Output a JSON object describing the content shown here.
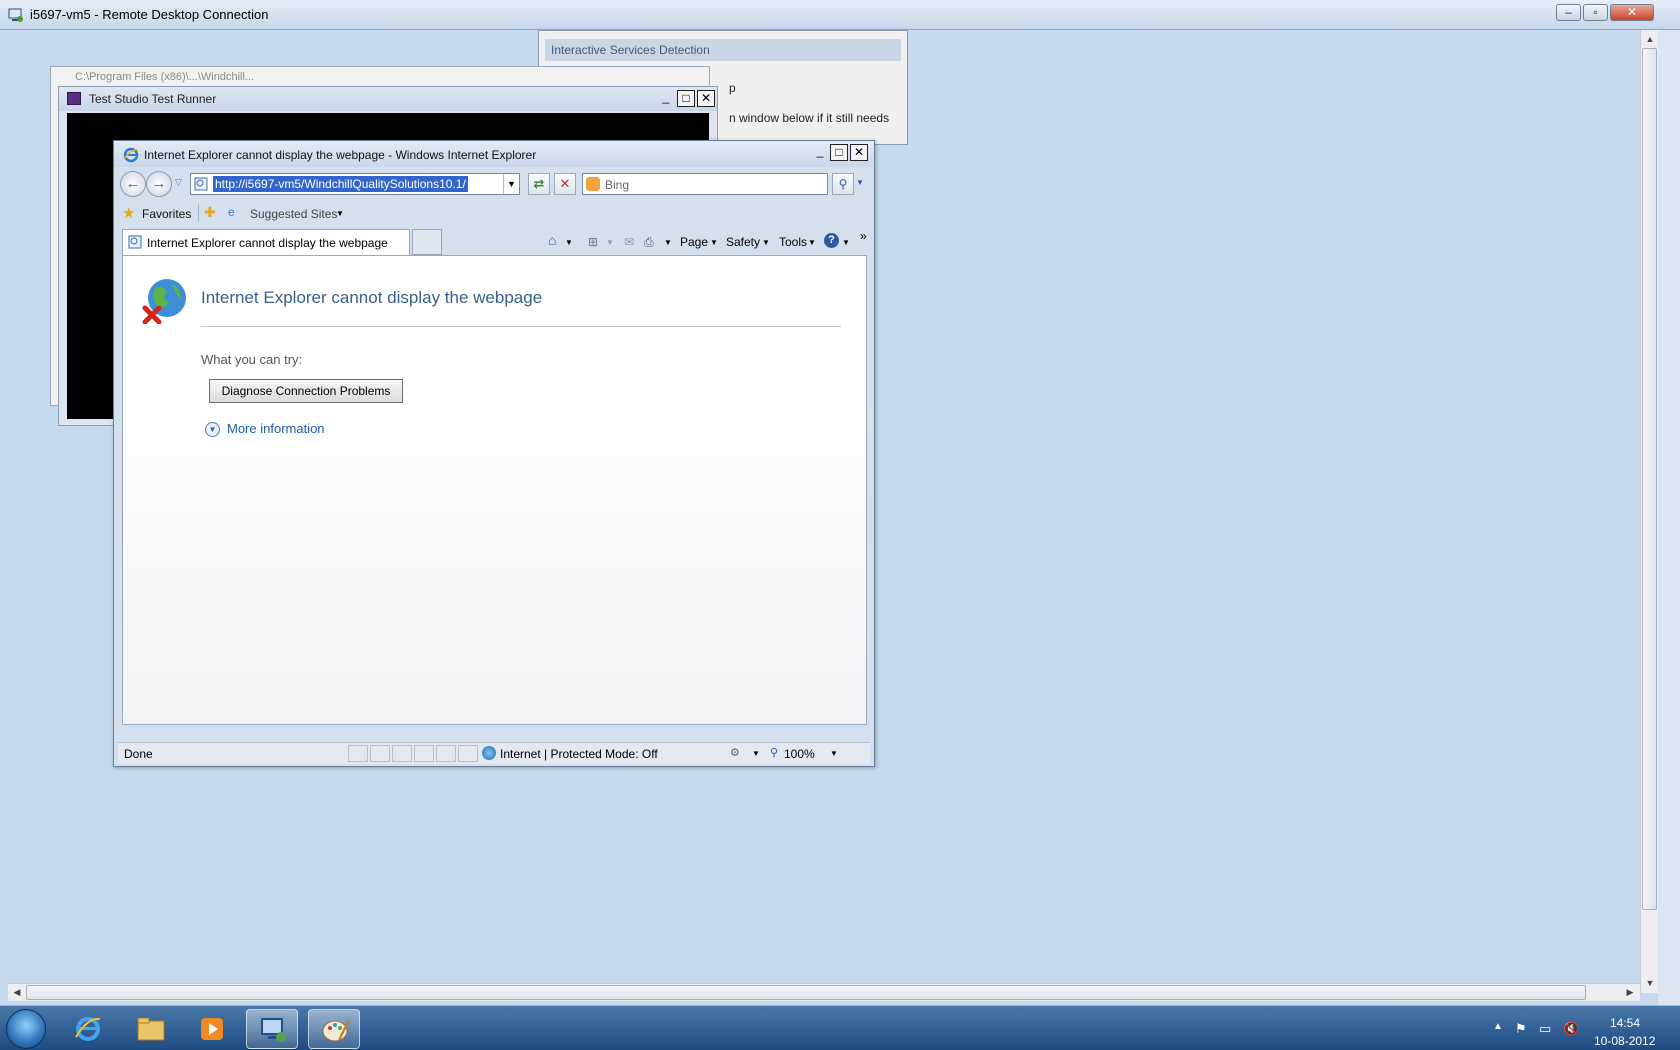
{
  "rdp": {
    "title": "i5697-vm5 - Remote Desktop Connection",
    "minimize": "–",
    "restore": "▫",
    "close": "✕"
  },
  "isd": {
    "title": "Interactive Services Detection",
    "line1": "p",
    "line2": "n window below if it still needs"
  },
  "back_window": {
    "title": "C:\\Program Files (x86)\\...\\Windchill..."
  },
  "test_runner": {
    "title": "Test Studio Test Runner"
  },
  "ie": {
    "title": "Internet Explorer cannot display the webpage - Windows Internet Explorer",
    "address": "http://i5697-vm5/WindchillQualitySolutions10.1/",
    "search_placeholder": "Bing",
    "favorites_label": "Favorites",
    "suggested_sites_label": "Suggested Sites",
    "tab_label": "Internet Explorer cannot display the webpage",
    "commands": {
      "page": "Page",
      "safety": "Safety",
      "tools": "Tools"
    },
    "content": {
      "heading": "Internet Explorer cannot display the webpage",
      "what_try": "What you can try:",
      "diagnose_button": "Diagnose Connection Problems",
      "more_info": "More information"
    },
    "status": {
      "text": "Done",
      "zone": "Internet | Protected Mode: Off",
      "zoom": "100%"
    }
  },
  "taskbar": {
    "items": [
      "start",
      "internet-explorer",
      "explorer",
      "media-player",
      "remote-desktop",
      "paint"
    ],
    "time": "14:54",
    "date": "10-08-2012"
  }
}
